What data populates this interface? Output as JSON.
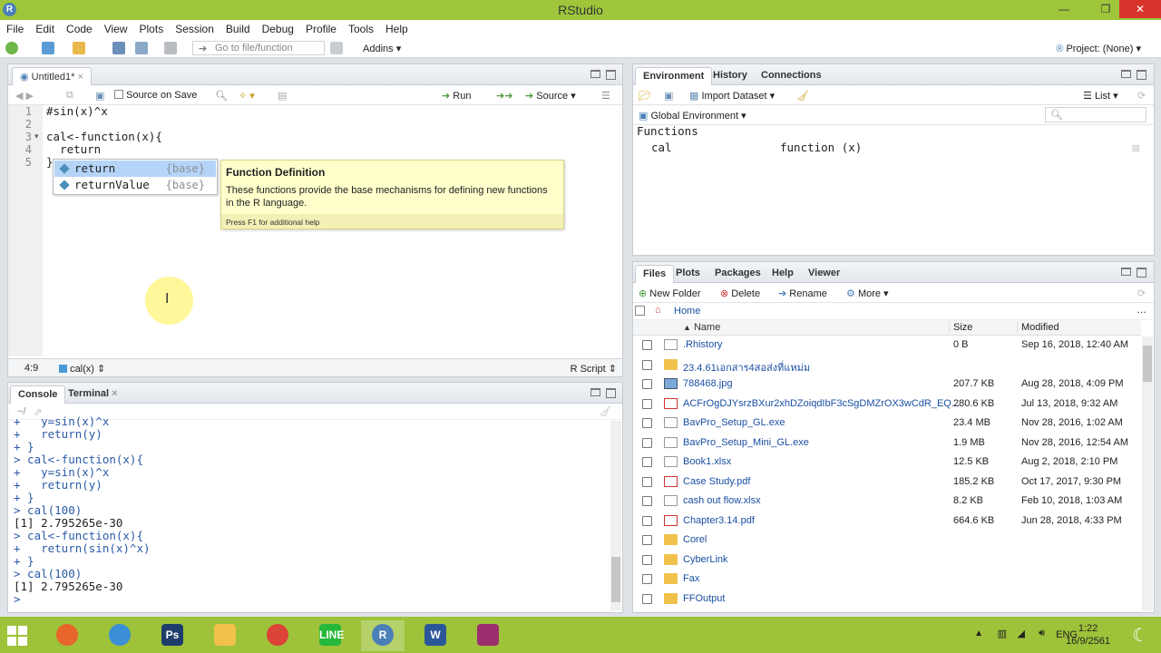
{
  "window": {
    "title": "RStudio"
  },
  "menu": [
    "File",
    "Edit",
    "Code",
    "View",
    "Plots",
    "Session",
    "Build",
    "Debug",
    "Profile",
    "Tools",
    "Help"
  ],
  "toolbar": {
    "goto_placeholder": "Go to file/function",
    "addins": "Addins",
    "project": "Project: (None)"
  },
  "editor": {
    "tab": "Untitled1*",
    "source_on_save": "Source on Save",
    "run": "Run",
    "source": "Source",
    "lines": [
      {
        "n": "1",
        "text": "#sin(x)^x"
      },
      {
        "n": "2",
        "text": ""
      },
      {
        "n": "3",
        "text": "cal<-function(x){"
      },
      {
        "n": "4",
        "text": "  return"
      },
      {
        "n": "5",
        "text": "}"
      }
    ],
    "autocomplete": [
      {
        "name": "return",
        "pkg": "{base}"
      },
      {
        "name": "returnValue",
        "pkg": "{base}"
      }
    ],
    "help": {
      "title": "Function Definition",
      "body": "These functions provide the base mechanisms for defining new functions in the R language.",
      "footer": "Press F1 for additional help"
    },
    "status_pos": "4:9",
    "status_scope": "cal(x)",
    "status_lang": "R Script"
  },
  "console": {
    "tabs": [
      "Console",
      "Terminal"
    ],
    "path": "~/",
    "lines": [
      {
        "text": "+   y=sin(x)^x",
        "type": "prompt"
      },
      {
        "text": "+   return(y)",
        "type": "prompt"
      },
      {
        "text": "+ }",
        "type": "prompt"
      },
      {
        "text": "> cal<-function(x){",
        "type": "prompt"
      },
      {
        "text": "+   y=sin(x)^x",
        "type": "prompt"
      },
      {
        "text": "+   return(y)",
        "type": "prompt"
      },
      {
        "text": "+ }",
        "type": "prompt"
      },
      {
        "text": "> cal(100)",
        "type": "prompt"
      },
      {
        "text": "[1] 2.795265e-30",
        "type": "out"
      },
      {
        "text": "> cal<-function(x){",
        "type": "prompt"
      },
      {
        "text": "+   return(sin(x)^x)",
        "type": "prompt"
      },
      {
        "text": "+ }",
        "type": "prompt"
      },
      {
        "text": "> cal(100)",
        "type": "prompt"
      },
      {
        "text": "[1] 2.795265e-30",
        "type": "out"
      },
      {
        "text": "> ",
        "type": "prompt"
      }
    ]
  },
  "env": {
    "tabs": [
      "Environment",
      "History",
      "Connections"
    ],
    "import": "Import Dataset",
    "list": "List",
    "scope": "Global Environment",
    "section": "Functions",
    "rows": [
      {
        "name": "cal",
        "value": "function (x)"
      }
    ]
  },
  "files": {
    "tabs": [
      "Files",
      "Plots",
      "Packages",
      "Help",
      "Viewer"
    ],
    "new_folder": "New Folder",
    "delete": "Delete",
    "rename": "Rename",
    "more": "More",
    "home": "Home",
    "col_name": "Name",
    "col_size": "Size",
    "col_modified": "Modified",
    "rows": [
      {
        "name": ".Rhistory",
        "size": "0 B",
        "modified": "Sep 16, 2018, 12:40 AM",
        "kind": "doc"
      },
      {
        "name": "23.4.61เอกสาร4สอส่งที่แหม่ม",
        "size": "",
        "modified": "",
        "kind": "folder"
      },
      {
        "name": "788468.jpg",
        "size": "207.7 KB",
        "modified": "Aug 28, 2018, 4:09 PM",
        "kind": "img"
      },
      {
        "name": "ACFrOgDJYsrzBXur2xhDZoiqdIbF3cSgDMZrOX3wCdR_EQ...",
        "size": "280.6 KB",
        "modified": "Jul 13, 2018, 9:32 AM",
        "kind": "pdf"
      },
      {
        "name": "BavPro_Setup_GL.exe",
        "size": "23.4 MB",
        "modified": "Nov 28, 2016, 1:02 AM",
        "kind": "doc"
      },
      {
        "name": "BavPro_Setup_Mini_GL.exe",
        "size": "1.9 MB",
        "modified": "Nov 28, 2016, 12:54 AM",
        "kind": "doc"
      },
      {
        "name": "Book1.xlsx",
        "size": "12.5 KB",
        "modified": "Aug 2, 2018, 2:10 PM",
        "kind": "doc"
      },
      {
        "name": "Case Study.pdf",
        "size": "185.2 KB",
        "modified": "Oct 17, 2017, 9:30 PM",
        "kind": "pdf"
      },
      {
        "name": "cash out flow.xlsx",
        "size": "8.2 KB",
        "modified": "Feb 10, 2018, 1:03 AM",
        "kind": "doc"
      },
      {
        "name": "Chapter3.14.pdf",
        "size": "664.6 KB",
        "modified": "Jun 28, 2018, 4:33 PM",
        "kind": "pdf"
      },
      {
        "name": "Corel",
        "size": "",
        "modified": "",
        "kind": "folder"
      },
      {
        "name": "CyberLink",
        "size": "",
        "modified": "",
        "kind": "folder"
      },
      {
        "name": "Fax",
        "size": "",
        "modified": "",
        "kind": "folder"
      },
      {
        "name": "FFOutput",
        "size": "",
        "modified": "",
        "kind": "folder"
      }
    ]
  },
  "taskbar": {
    "apps": [
      {
        "name": "firefox",
        "label": "",
        "color": "#e8662b"
      },
      {
        "name": "browser2",
        "label": "",
        "color": "#3a8fd6"
      },
      {
        "name": "photoshop",
        "label": "Ps",
        "color": "#1f3d6b"
      },
      {
        "name": "explorer",
        "label": "",
        "color": "#f0c14b"
      },
      {
        "name": "chrome",
        "label": "",
        "color": "#db4437"
      },
      {
        "name": "line",
        "label": "LINE",
        "color": "#25b83a"
      },
      {
        "name": "rstudio",
        "label": "R",
        "color": "#4b7fb8"
      },
      {
        "name": "word",
        "label": "W",
        "color": "#2b579a"
      },
      {
        "name": "teams",
        "label": "",
        "color": "#9b2f6e"
      }
    ],
    "lang": "ENG",
    "time": "1:22",
    "date": "16/9/2561"
  }
}
